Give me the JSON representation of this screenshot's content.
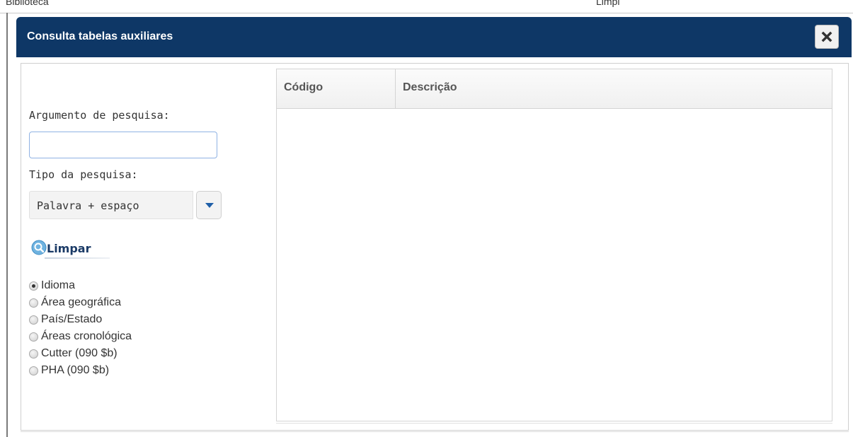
{
  "background": {
    "left_text": "Biblioteca",
    "right_text": "Limpi"
  },
  "dialog": {
    "title": "Consulta tabelas auxiliares",
    "close_icon": "close-icon",
    "title_bar_color": "#0e3766"
  },
  "search": {
    "argument_label": "Argumento de pesquisa:",
    "argument_value": "",
    "type_label": "Tipo da pesquisa:",
    "type_selected": "Palavra + espaço",
    "clear_label": "Limpar",
    "clear_icon": "magnifier-icon",
    "table_options": [
      {
        "label": "Idioma",
        "checked": true
      },
      {
        "label": "Área geográfica",
        "checked": false
      },
      {
        "label": "País/Estado",
        "checked": false
      },
      {
        "label": "Áreas cronológica",
        "checked": false
      },
      {
        "label": "Cutter (090 $b)",
        "checked": false
      },
      {
        "label": "PHA (090 $b)",
        "checked": false
      }
    ]
  },
  "grid": {
    "columns": [
      "Código",
      "Descrição"
    ],
    "rows": []
  }
}
